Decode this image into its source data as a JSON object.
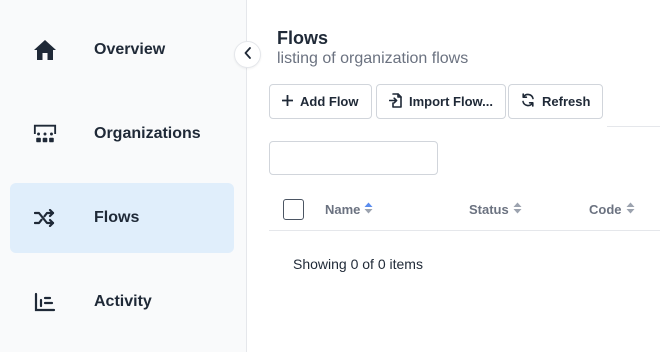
{
  "sidebar": {
    "items": [
      {
        "label": "Overview",
        "icon": "home-icon",
        "active": false
      },
      {
        "label": "Organizations",
        "icon": "organizations-icon",
        "active": false
      },
      {
        "label": "Flows",
        "icon": "shuffle-icon",
        "active": true
      },
      {
        "label": "Activity",
        "icon": "bar-chart-icon",
        "active": false
      }
    ]
  },
  "header": {
    "title": "Flows",
    "subtitle": "listing of organization flows"
  },
  "toolbar": {
    "add_label": "Add Flow",
    "import_label": "Import Flow...",
    "refresh_label": "Refresh"
  },
  "search": {
    "value": "",
    "placeholder": ""
  },
  "table": {
    "columns": [
      "Name",
      "Status",
      "Code"
    ],
    "sorted_column": "Name",
    "rows": []
  },
  "footer": {
    "summary": "Showing 0 of 0 items"
  },
  "colors": {
    "active_nav_bg": "#e0eefb",
    "sort_active": "#5b8def",
    "text": "#1f2937",
    "muted": "#6b7280"
  }
}
